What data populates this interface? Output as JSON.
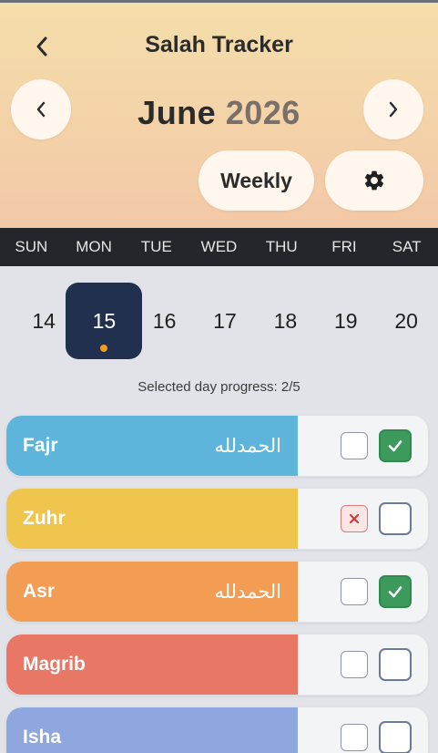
{
  "header": {
    "title": "Salah Tracker",
    "month": "June",
    "year": "2026",
    "view_toggle_label": "Weekly",
    "colors": {
      "gradient_top": "#f4deaa",
      "gradient_bottom": "#f3c8a7"
    }
  },
  "icons": {
    "back": "chevron-left-icon",
    "prev_month": "chevron-left-icon",
    "next_month": "chevron-right-icon",
    "settings": "gear-icon",
    "missed": "x-icon",
    "done": "check-icon"
  },
  "weekdays": [
    "SUN",
    "MON",
    "TUE",
    "WED",
    "THU",
    "FRI",
    "SAT"
  ],
  "days": [
    {
      "num": "14",
      "selected": false
    },
    {
      "num": "15",
      "selected": true,
      "has_dot": true
    },
    {
      "num": "16",
      "selected": false
    },
    {
      "num": "17",
      "selected": false
    },
    {
      "num": "18",
      "selected": false
    },
    {
      "num": "19",
      "selected": false
    },
    {
      "num": "20",
      "selected": false
    }
  ],
  "progress": {
    "text": "Selected day progress: 2/5",
    "completed": 2,
    "total": 5
  },
  "prayers": [
    {
      "name": "Fajr",
      "dua": "الحمدلله",
      "color": "#5db5dc",
      "missed": false,
      "done": true
    },
    {
      "name": "Zuhr",
      "dua": "",
      "color": "#efc54e",
      "missed": true,
      "done": false
    },
    {
      "name": "Asr",
      "dua": "الحمدلله",
      "color": "#f29c54",
      "missed": false,
      "done": true
    },
    {
      "name": "Magrib",
      "dua": "",
      "color": "#e87766",
      "missed": false,
      "done": false
    },
    {
      "name": "Isha",
      "dua": "",
      "color": "#8ea7de",
      "missed": false,
      "done": false
    }
  ],
  "accent_colors": {
    "selected_day": "#22304f",
    "dot": "#f29b1c",
    "done": "#3c9b5c",
    "missed": "#d77b7b"
  }
}
